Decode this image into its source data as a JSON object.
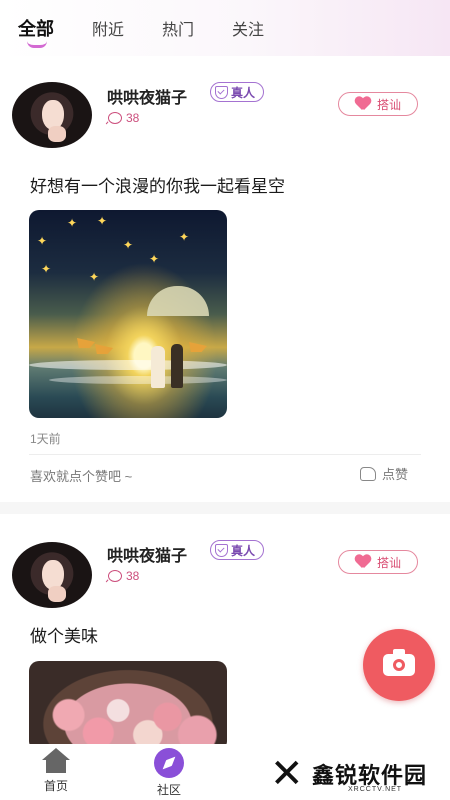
{
  "top_tabs": [
    {
      "label": "全部",
      "active": true
    },
    {
      "label": "附近",
      "active": false
    },
    {
      "label": "热门",
      "active": false
    },
    {
      "label": "关注",
      "active": false
    }
  ],
  "posts": [
    {
      "username": "哄哄夜猫子",
      "badge": "真人",
      "count": "38",
      "greet_label": "搭讪",
      "text": "好想有一个浪漫的你我一起看星空",
      "image": "couple-beach-starry-night",
      "time": "1天前",
      "like_prompt": "喜欢就点个赞吧 ~",
      "like_label": "点赞"
    },
    {
      "username": "哄哄夜猫子",
      "badge": "真人",
      "count": "38",
      "greet_label": "搭讪",
      "text": "做个美味",
      "image": "bowl-of-pink-dumplings"
    }
  ],
  "fab": {
    "icon": "camera-icon",
    "color": "#ef5b61"
  },
  "bottom_nav": [
    {
      "label": "首页",
      "icon": "home-icon",
      "active": false
    },
    {
      "label": "社区",
      "icon": "compass-icon",
      "active": true
    }
  ],
  "watermark": {
    "brand": "鑫锐软件园",
    "site": "XRCCTV.NET"
  },
  "colors": {
    "accent": "#8a4fd8",
    "pink": "#d94c72",
    "badge": "#a472d1"
  }
}
